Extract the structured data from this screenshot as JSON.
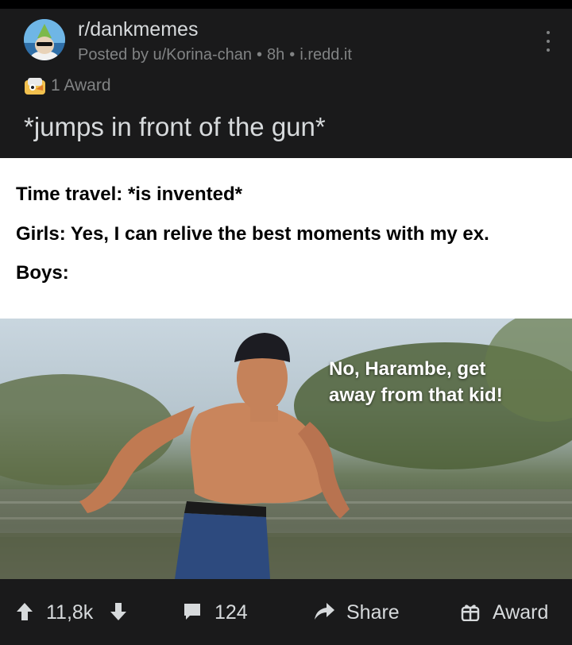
{
  "post": {
    "subreddit": "r/dankmemes",
    "posted_by": "Posted by u/Korina-chan",
    "age": "8h",
    "domain": "i.redd.it",
    "awards": "1 Award",
    "title": "*jumps in front of the gun*"
  },
  "meme": {
    "lines": [
      "Time travel: *is invented*",
      "Girls: Yes, I can relive the best moments with my ex.",
      "Boys:"
    ],
    "caption_line1": "No, Harambe, get",
    "caption_line2": "away from that kid!"
  },
  "actions": {
    "score": "11,8k",
    "comments": "124",
    "share": "Share",
    "award": "Award"
  },
  "icons": [
    "subreddit-avatar",
    "more-options-icon",
    "award-badge-icon",
    "upvote-icon",
    "downvote-icon",
    "comment-icon",
    "share-icon",
    "award-gift-icon"
  ],
  "colors": {
    "background": "#000000",
    "card": "#1a1a1b",
    "text": "#d7dadc",
    "muted": "#818384"
  }
}
